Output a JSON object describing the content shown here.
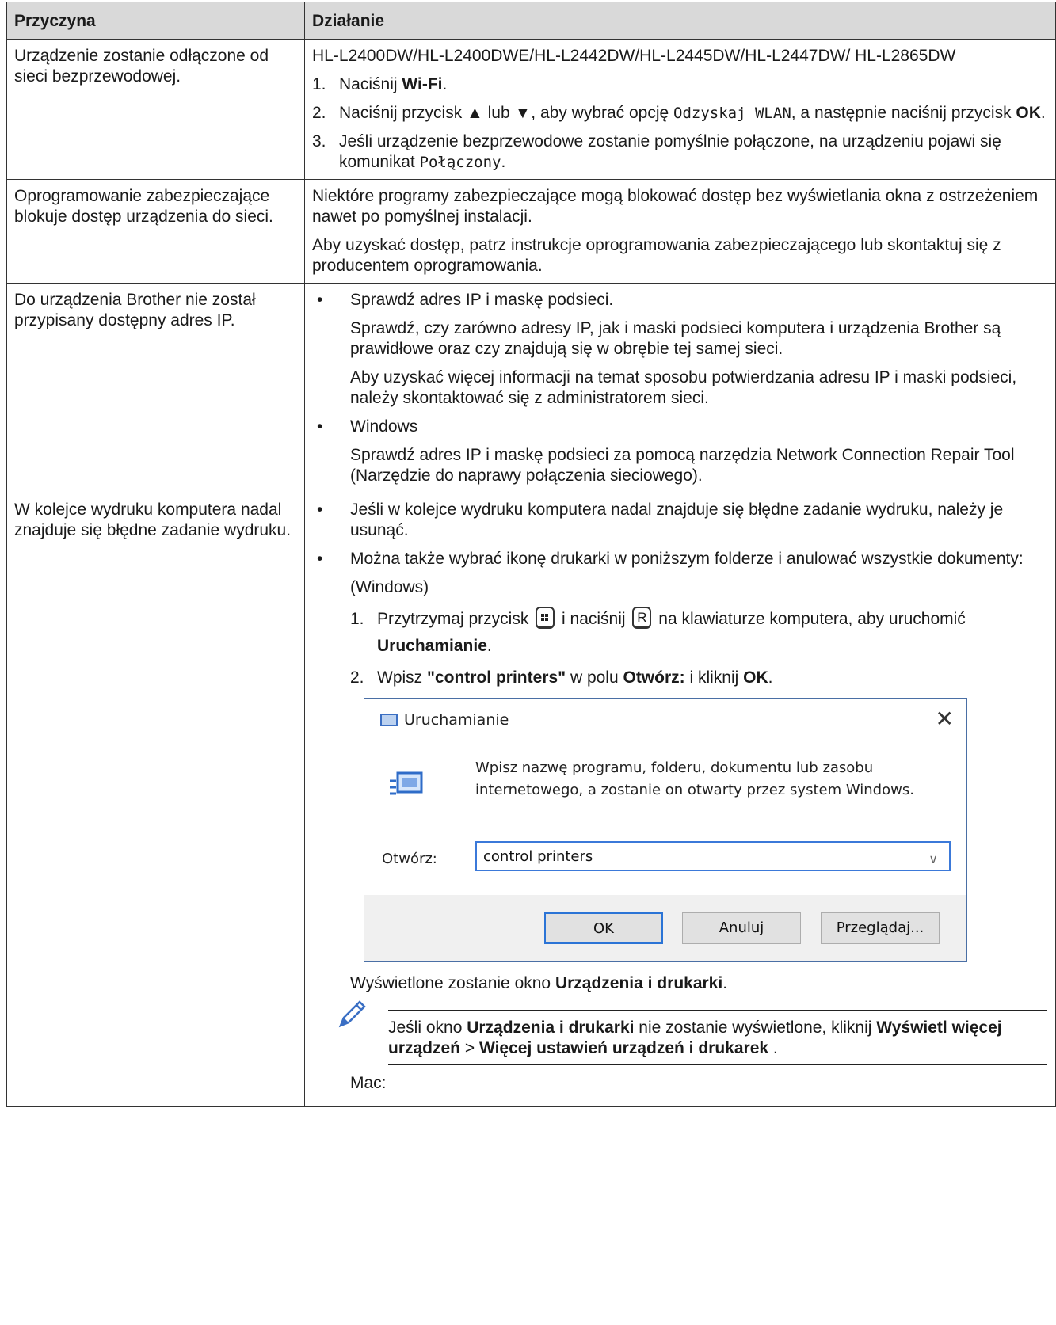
{
  "header": {
    "col1": "Przyczyna",
    "col2": "Działanie"
  },
  "rows": [
    {
      "cause": "Urządzenie zostanie odłączone od sieci bezprzewodowej.",
      "models": "HL-L2400DW/HL-L2400DWE/HL-L2442DW/HL-L2445DW/HL-L2447DW/ HL-L2865DW",
      "steps": [
        {
          "num": "1.",
          "a": "Naciśnij ",
          "b": "Wi-Fi",
          "c": "."
        },
        {
          "num": "2.",
          "a": "Naciśnij przycisk ▲ lub ▼, aby wybrać opcję ",
          "mono": "Odzyskaj WLAN",
          "c": ", a następnie naciśnij przycisk ",
          "b": "OK",
          "d": "."
        },
        {
          "num": "3.",
          "a": "Jeśli urządzenie bezprzewodowe zostanie pomyślnie połączone, na urządzeniu pojawi się komunikat ",
          "mono": "Połączony",
          "c": "."
        }
      ]
    },
    {
      "cause": "Oprogramowanie zabezpieczające blokuje dostęp urządzenia do sieci.",
      "p1": "Niektóre programy zabezpieczające mogą blokować dostęp bez wyświetlania okna z ostrzeżeniem nawet po pomyślnej instalacji.",
      "p2": "Aby uzyskać dostęp, patrz instrukcje oprogramowania zabezpieczającego lub skontaktuj się z producentem oprogramowania."
    },
    {
      "cause": "Do urządzenia Brother nie został przypisany dostępny adres IP.",
      "b1": "Sprawdź adres IP i maskę podsieci.",
      "b1p1": "Sprawdź, czy zarówno adresy IP, jak i maski podsieci komputera i urządzenia Brother są prawidłowe oraz czy znajdują się w obrębie tej samej sieci.",
      "b1p2": "Aby uzyskać więcej informacji na temat sposobu potwierdzania adresu IP i maski podsieci, należy skontaktować się z administratorem sieci.",
      "b2": "Windows",
      "b2p1": "Sprawdź adres IP i maskę podsieci za pomocą narzędzia Network Connection Repair Tool (Narzędzie do naprawy połączenia sieciowego)."
    },
    {
      "cause": "W kolejce wydruku komputera nadal znajduje się błędne zadanie wydruku.",
      "b1": "Jeśli w kolejce wydruku komputera nadal znajduje się błędne zadanie wydruku, należy je usunąć.",
      "b2": "Można także wybrać ikonę drukarki w poniższym folderze i anulować wszystkie dokumenty:",
      "os_windows": "(Windows)",
      "step1": {
        "num": "1.",
        "a": "Przytrzymaj przycisk",
        "b": "i naciśnij",
        "key_r": "R",
        "c": "na klawiaturze komputera, aby uruchomić ",
        "bold": "Uruchamianie",
        "d": "."
      },
      "step2": {
        "num": "2.",
        "a": "Wpisz ",
        "b1": "\"control printers\"",
        "c": " w polu ",
        "b2": "Otwórz:",
        "d": " i kliknij ",
        "b3": "OK",
        "e": "."
      },
      "dialog": {
        "title": "Uruchamianie",
        "close": "✕",
        "text": "Wpisz nazwę programu, folderu, dokumentu lub zasobu internetowego, a zostanie on otwarty przez system Windows.",
        "label": "Otwórz:",
        "input_value": "control printers",
        "ok": "OK",
        "cancel": "Anuluj",
        "browse": "Przeglądaj..."
      },
      "after": {
        "a": "Wyświetlone zostanie okno ",
        "b": "Urządzenia i drukarki",
        "c": "."
      },
      "note": {
        "a": "Jeśli okno ",
        "b": "Urządzenia i drukarki",
        "c": " nie zostanie wyświetlone, kliknij ",
        "d": "Wyświetl więcej urządzeń",
        "e": " > ",
        "f": "Więcej ustawień urządzeń i drukarek",
        "g": " ."
      },
      "os_mac": "Mac:"
    }
  ]
}
